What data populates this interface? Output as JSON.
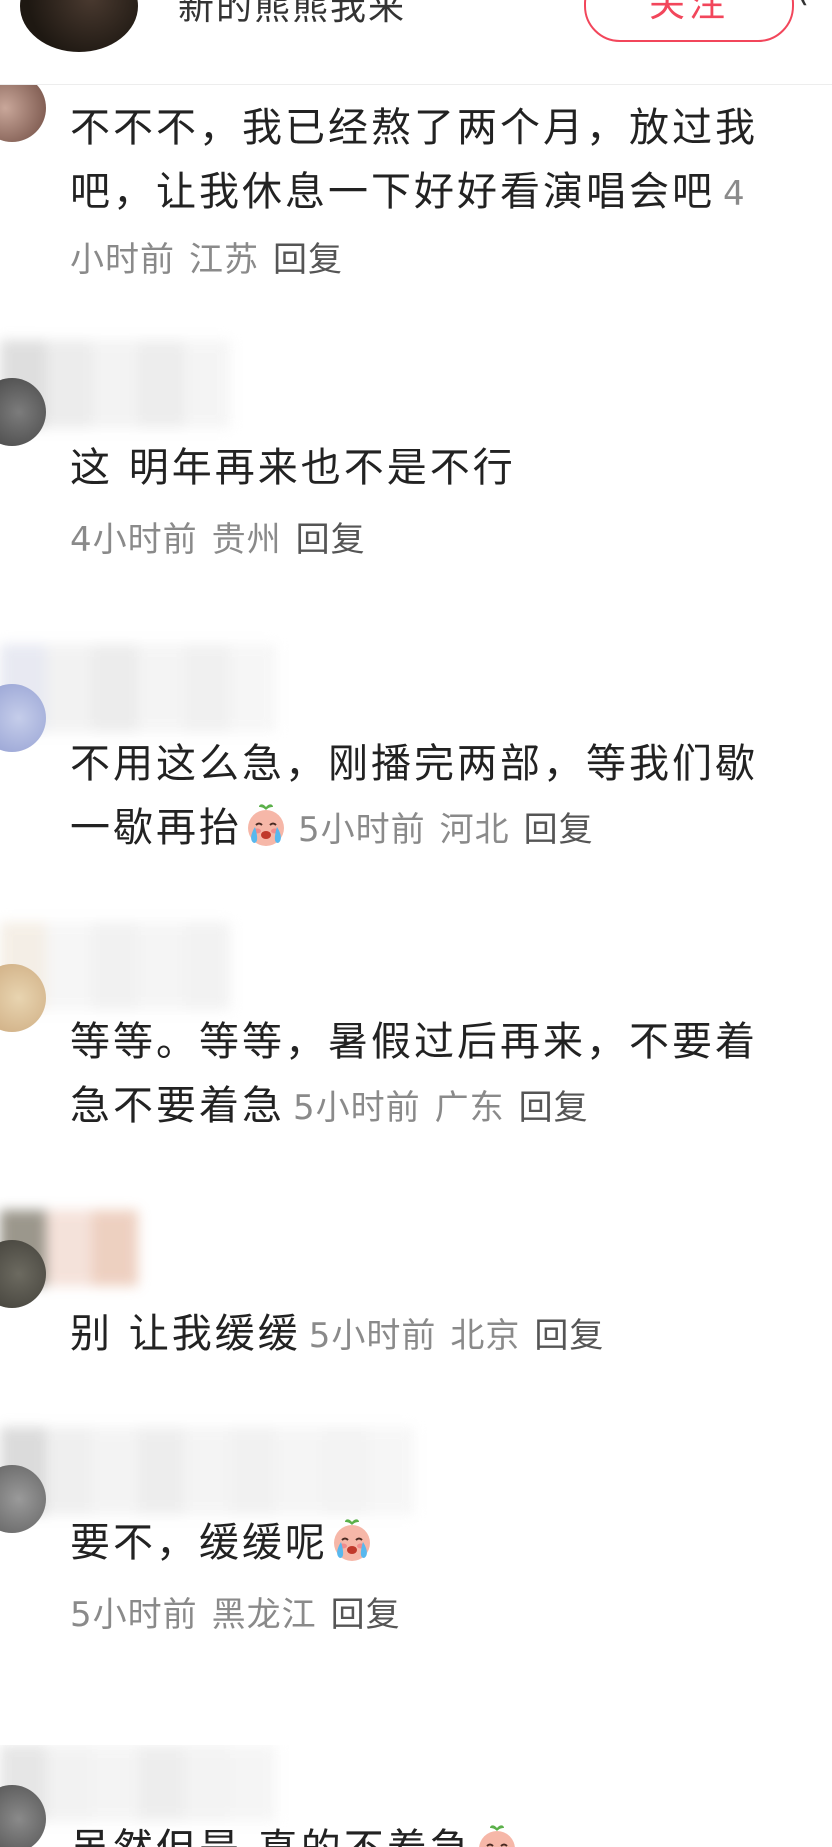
{
  "header": {
    "name": "新的熊熊我来",
    "follow_label": "关注",
    "menu_glyph": "("
  },
  "emoji_name": "crying-peach-emoji",
  "comments": [
    {
      "text": "不不不，我已经熬了两个月，放过我吧，让我休息一下好好看演唱会吧",
      "time": "4小时前",
      "location": "江苏",
      "reply": "回复"
    },
    {
      "text": "这 明年再来也不是不行",
      "time": "4小时前",
      "location": "贵州",
      "reply": "回复"
    },
    {
      "text": "不用这么急，刚播完两部，等我们歇一歇再抬",
      "time": "5小时前",
      "location": "河北",
      "reply": "回复"
    },
    {
      "text": "等等。等等，暑假过后再来，不要着急不要着急",
      "time": "5小时前",
      "location": "广东",
      "reply": "回复"
    },
    {
      "text": "别 让我缓缓",
      "time": "5小时前",
      "location": "北京",
      "reply": "回复"
    },
    {
      "text": "要不，缓缓呢",
      "time": "5小时前",
      "location": "黑龙江",
      "reply": "回复"
    },
    {
      "text": "虽然但是 真的不着急"
    }
  ]
}
